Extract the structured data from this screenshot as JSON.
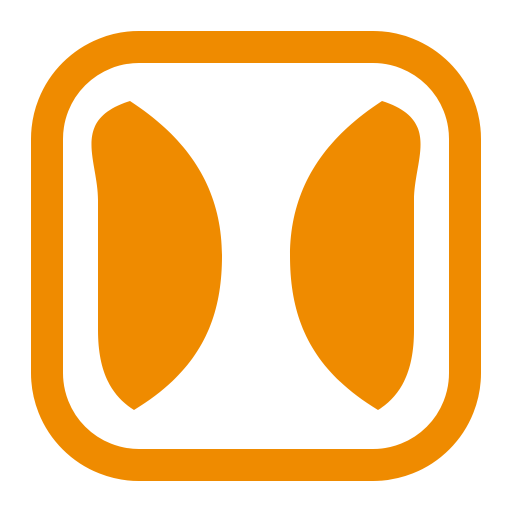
{
  "icon": {
    "name": "app-logo-icon",
    "accent_color": "#ef8b00",
    "background_color": "#ffffff"
  }
}
